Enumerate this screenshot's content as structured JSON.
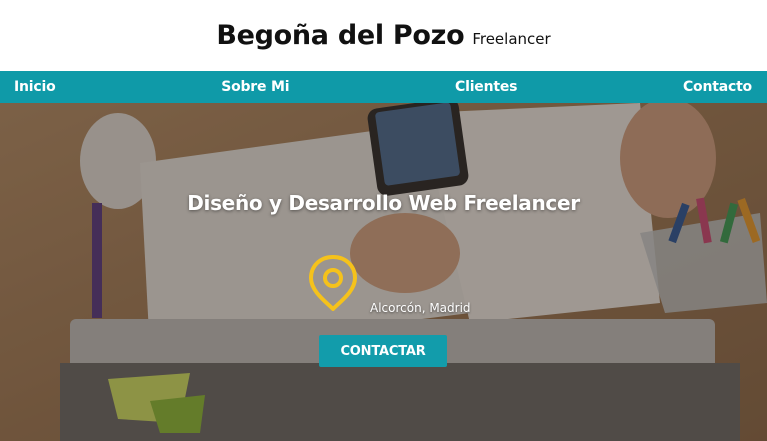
{
  "header": {
    "title": "Begoña del Pozo",
    "subtitle": "Freelancer"
  },
  "nav": {
    "items": [
      {
        "label": "Inicio"
      },
      {
        "label": "Sobre Mi"
      },
      {
        "label": "Clientes"
      },
      {
        "label": "Contacto"
      }
    ]
  },
  "hero": {
    "headline": "Diseño y Desarrollo Web Freelancer",
    "location": "Alcorcón, Madrid",
    "location_icon": "map-pin-icon",
    "cta_label": "CONTACTAR"
  },
  "colors": {
    "nav_bg": "#0f9aa8",
    "cta_bg": "#129cab",
    "pin": "#f5c21b"
  }
}
